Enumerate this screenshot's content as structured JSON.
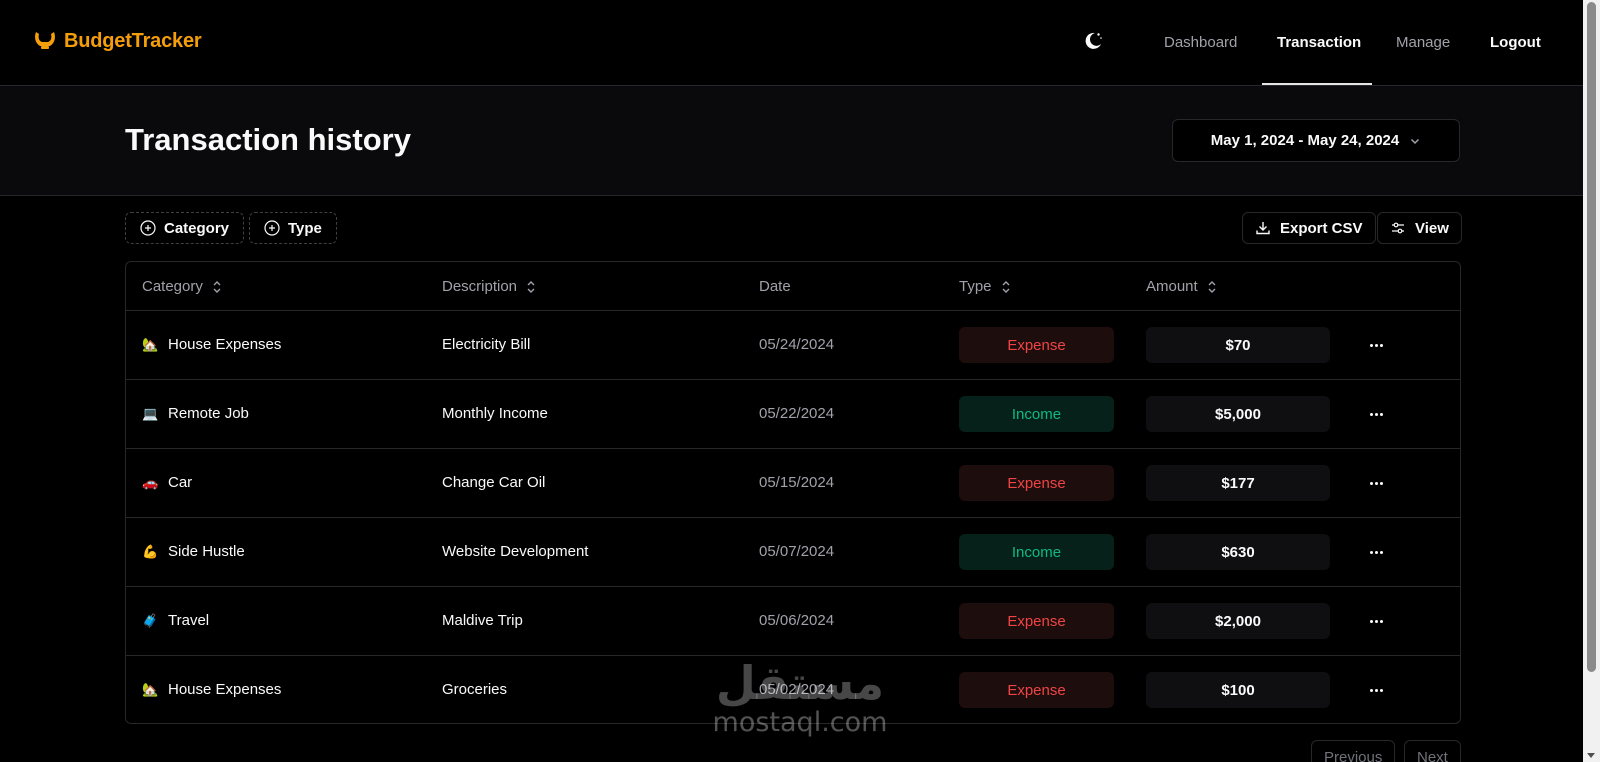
{
  "app": {
    "name": "BudgetTracker",
    "accent_color": "#f59e0b"
  },
  "nav": {
    "theme_icon": "moon-icon",
    "items": [
      {
        "label": "Dashboard",
        "active": false
      },
      {
        "label": "Transaction",
        "active": true
      },
      {
        "label": "Manage",
        "active": false
      },
      {
        "label": "Logout",
        "active": false
      }
    ]
  },
  "header": {
    "title": "Transaction history",
    "date_range": "May 1, 2024 - May 24, 2024"
  },
  "toolbar": {
    "filters": [
      {
        "label": "Category",
        "icon": "plus-circle-icon"
      },
      {
        "label": "Type",
        "icon": "plus-circle-icon"
      }
    ],
    "export_label": "Export CSV",
    "view_label": "View"
  },
  "table": {
    "columns": [
      "Category",
      "Description",
      "Date",
      "Type",
      "Amount"
    ],
    "rows": [
      {
        "icon": "🏡",
        "category": "House Expenses",
        "description": "Electricity Bill",
        "date": "05/24/2024",
        "type": "Expense",
        "amount": "$70"
      },
      {
        "icon": "💻",
        "category": "Remote Job",
        "description": "Monthly Income",
        "date": "05/22/2024",
        "type": "Income",
        "amount": "$5,000"
      },
      {
        "icon": "🚗",
        "category": "Car",
        "description": "Change Car Oil",
        "date": "05/15/2024",
        "type": "Expense",
        "amount": "$177"
      },
      {
        "icon": "💪",
        "category": "Side Hustle",
        "description": "Website Development",
        "date": "05/07/2024",
        "type": "Income",
        "amount": "$630"
      },
      {
        "icon": "🧳",
        "category": "Travel",
        "description": "Maldive Trip",
        "date": "05/06/2024",
        "type": "Expense",
        "amount": "$2,000"
      },
      {
        "icon": "🏡",
        "category": "House Expenses",
        "description": "Groceries",
        "date": "05/02/2024",
        "type": "Expense",
        "amount": "$100"
      }
    ]
  },
  "pagination": {
    "previous_label": "Previous",
    "next_label": "Next"
  },
  "watermark": {
    "arabic": "مستقل",
    "latin": "mostaql.com"
  },
  "colors": {
    "expense": "#ef4444",
    "income": "#10b981"
  }
}
